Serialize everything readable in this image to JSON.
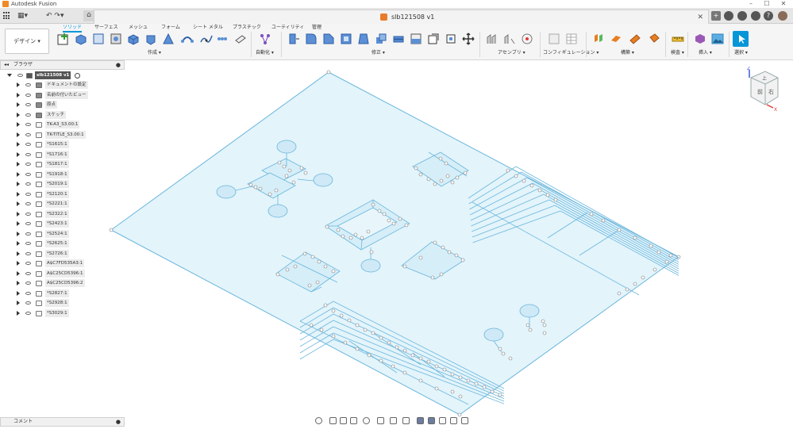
{
  "window": {
    "app_title": "Autodesk Fusion",
    "controls": [
      "–",
      "☐",
      "✕"
    ]
  },
  "document": {
    "tab_title": "slb121508 v1",
    "close": "✕"
  },
  "quick_access": [
    "▦▾",
    "↶ ↷▾",
    "⌂"
  ],
  "workspace": {
    "label": "デザイン ▾"
  },
  "ribbon_tabs": [
    "ソリッド",
    "サーフェス",
    "メッシュ",
    "フォーム",
    "シート メタル",
    "プラスチック",
    "ユーティリティ",
    "管理"
  ],
  "ribbon_groups": [
    "作成 ▾",
    "自動化 ▾",
    "修正 ▾",
    "アセンブリ ▾",
    "コンフィギュレーション ▾",
    "構築 ▾",
    "検査 ▾",
    "挿入 ▾",
    "選択 ▾"
  ],
  "browser": {
    "title": "ブラウザ",
    "root": "slb121508 v1",
    "items": [
      "ドキュメントの設定",
      "名前の付いたビュー",
      "原点",
      "スケッチ",
      "TK-A3_S3.00:1",
      "TK-TITLE_S3.00:1",
      "*S1615:1",
      "*S1716:1",
      "*S1817:1",
      "*S1918:1",
      "*S2019:1",
      "*S2120:1",
      "*S2221:1",
      "*S2322:1",
      "*S2423:1",
      "*S2524:1",
      "*S2625:1",
      "*S2726:1",
      "A$C7FD535A3:1",
      "A$C25CD5396:1",
      "A$C25CD5396:2",
      "*S2827:1",
      "*S2928:1",
      "*S3029:1"
    ]
  },
  "comments": {
    "title": "コメント"
  },
  "viewcube": {
    "top": "上",
    "front": "前",
    "right": "右",
    "axis_x": "X",
    "axis_z": "Z"
  },
  "colors": {
    "accent": "#0696d7",
    "plane_fill": "#e3f4fb",
    "plane_stroke": "#6ab6dc",
    "brand_orange": "#e87c2a"
  }
}
